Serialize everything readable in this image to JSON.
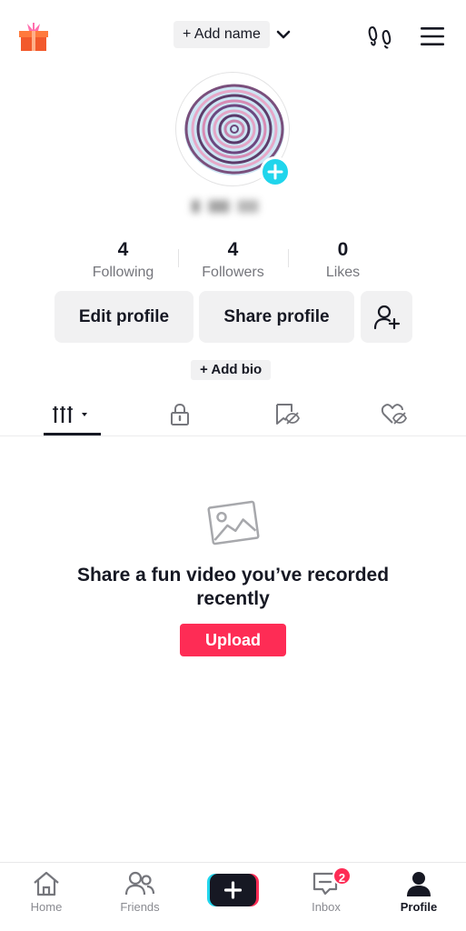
{
  "header": {
    "add_name_label": "+ Add name",
    "icons": [
      "gift-icon",
      "chevron-down-icon",
      "footprint-icon",
      "menu-icon"
    ]
  },
  "profile": {
    "username": "",
    "stats": [
      {
        "value": "4",
        "label": "Following"
      },
      {
        "value": "4",
        "label": "Followers"
      },
      {
        "value": "0",
        "label": "Likes"
      }
    ],
    "edit_profile_label": "Edit profile",
    "share_profile_label": "Share profile",
    "add_bio_label": "+ Add bio"
  },
  "tabs": [
    {
      "name": "videos",
      "icon": "grid-icon",
      "active": true
    },
    {
      "name": "private",
      "icon": "lock-icon",
      "active": false
    },
    {
      "name": "favorites",
      "icon": "bookmark-hidden-icon",
      "active": false
    },
    {
      "name": "liked",
      "icon": "heart-hidden-icon",
      "active": false
    }
  ],
  "empty_state": {
    "title": "Share a fun video you’ve recorded recently",
    "button_label": "Upload"
  },
  "bottom_nav": {
    "items": [
      {
        "label": "Home",
        "icon": "home-icon"
      },
      {
        "label": "Friends",
        "icon": "friends-icon"
      },
      {
        "label": "",
        "icon": "create-icon"
      },
      {
        "label": "Inbox",
        "icon": "inbox-icon",
        "badge": "2"
      },
      {
        "label": "Profile",
        "icon": "profile-icon",
        "active": true
      }
    ]
  },
  "colors": {
    "accent": "#fe2c55",
    "cyan": "#20d5ec",
    "text_primary": "#161823",
    "text_secondary": "#75767c",
    "pill_bg": "#f1f1f2"
  }
}
